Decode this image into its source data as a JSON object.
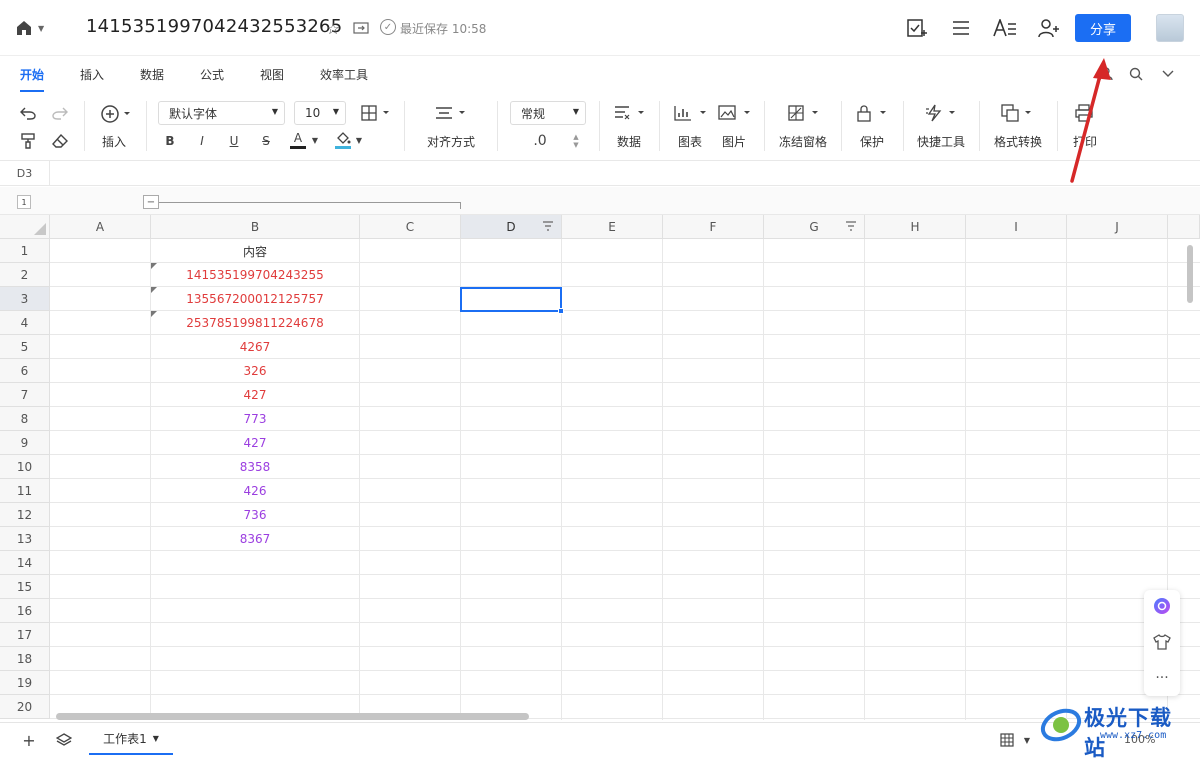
{
  "header": {
    "doc_title": "1415351997042432553265",
    "save_status": "最近保存 10:58",
    "share_label": "分享"
  },
  "tabs": [
    "开始",
    "插入",
    "数据",
    "公式",
    "视图",
    "效率工具"
  ],
  "ribbon": {
    "insert": "插入",
    "font_name": "默认字体",
    "font_size": "10",
    "bold": "B",
    "italic": "I",
    "underline": "U",
    "strike": "S",
    "font_color": "A",
    "align": "对齐方式",
    "number_format": "常规",
    "decimal": ".0",
    "data": "数据",
    "chart": "图表",
    "picture": "图片",
    "freeze": "冻结窗格",
    "protect": "保护",
    "quick_tools": "快捷工具",
    "format_convert": "格式转换",
    "print": "打印"
  },
  "cell_ref": "D3",
  "group_level": "1",
  "columns": [
    "A",
    "B",
    "C",
    "D",
    "E",
    "F",
    "G",
    "H",
    "I",
    "J"
  ],
  "rows": [
    "1",
    "2",
    "3",
    "4",
    "5",
    "6",
    "7",
    "8",
    "9",
    "10",
    "11",
    "12",
    "13",
    "14",
    "15",
    "16",
    "17",
    "18",
    "19",
    "20"
  ],
  "column_b": [
    {
      "row": 1,
      "value": "内容",
      "color": "#333333"
    },
    {
      "row": 2,
      "value": "141535199704243255",
      "color": "#e03c3c"
    },
    {
      "row": 3,
      "value": "135567200012125757",
      "color": "#e03c3c"
    },
    {
      "row": 4,
      "value": "253785199811224678",
      "color": "#e03c3c"
    },
    {
      "row": 5,
      "value": "4267",
      "color": "#e03c3c"
    },
    {
      "row": 6,
      "value": "326",
      "color": "#e03c3c"
    },
    {
      "row": 7,
      "value": "427",
      "color": "#e03c3c"
    },
    {
      "row": 8,
      "value": "773",
      "color": "#9b3ee0"
    },
    {
      "row": 9,
      "value": "427",
      "color": "#9b3ee0"
    },
    {
      "row": 10,
      "value": "8358",
      "color": "#9b3ee0"
    },
    {
      "row": 11,
      "value": "426",
      "color": "#9b3ee0"
    },
    {
      "row": 12,
      "value": "736",
      "color": "#9b3ee0"
    },
    {
      "row": 13,
      "value": "8367",
      "color": "#9b3ee0"
    }
  ],
  "sheet": {
    "name": "工作表1",
    "zoom": "100%"
  },
  "watermark": {
    "text": "极光下载站",
    "url": "www.xz7.com"
  },
  "colors": {
    "accent": "#1b6ef3",
    "red_text": "#e03c3c",
    "purple_text": "#9b3ee0",
    "annotation_arrow": "#d62828"
  }
}
